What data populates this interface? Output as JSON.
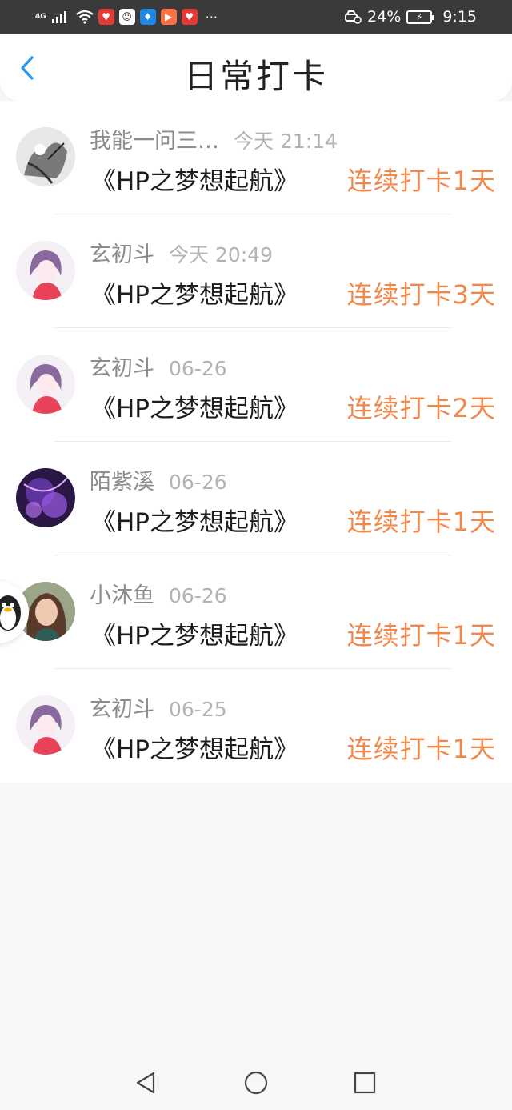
{
  "status_bar": {
    "network": "4G",
    "battery_percent": "24%",
    "time": "9:15",
    "more_dots": "···"
  },
  "header": {
    "title": "日常打卡"
  },
  "checkins": [
    {
      "user": "我能一问三…",
      "time": "今天 21:14",
      "book": "《HP之梦想起航》",
      "streak": "连续打卡1天",
      "avatar": "sketch"
    },
    {
      "user": "玄初斗",
      "time": "今天 20:49",
      "book": "《HP之梦想起航》",
      "streak": "连续打卡3天",
      "avatar": "girl"
    },
    {
      "user": "玄初斗",
      "time": "06-26",
      "book": "《HP之梦想起航》",
      "streak": "连续打卡2天",
      "avatar": "girl"
    },
    {
      "user": "陌紫溪",
      "time": "06-26",
      "book": "《HP之梦想起航》",
      "streak": "连续打卡1天",
      "avatar": "purple"
    },
    {
      "user": "小沐鱼",
      "time": "06-26",
      "book": "《HP之梦想起航》",
      "streak": "连续打卡1天",
      "avatar": "photo"
    },
    {
      "user": "玄初斗",
      "time": "06-25",
      "book": "《HP之梦想起航》",
      "streak": "连续打卡1天",
      "avatar": "girl"
    }
  ],
  "colors": {
    "accent_orange": "#f2874a",
    "back_blue": "#2196f3"
  }
}
